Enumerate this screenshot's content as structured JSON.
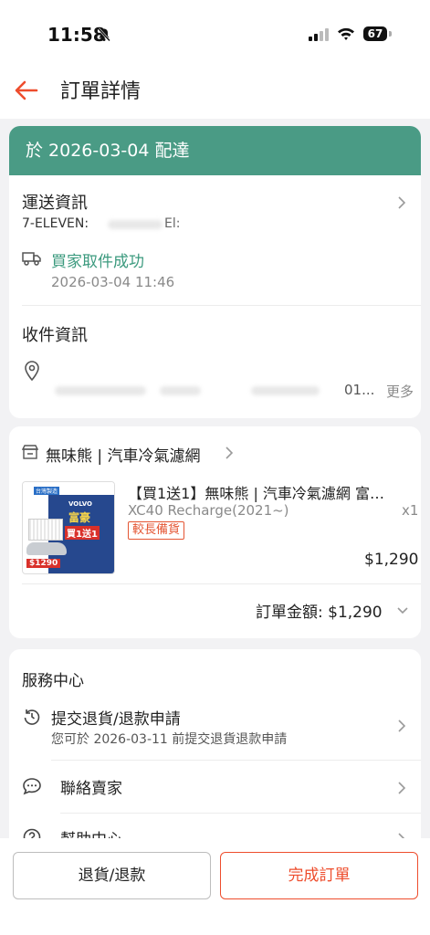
{
  "status_bar": {
    "time": "11:58",
    "battery": "67"
  },
  "header": {
    "title": "訂單詳情"
  },
  "delivery": {
    "banner": "於 2026-03-04 配達"
  },
  "shipping": {
    "title": "運送資訊",
    "store": "7-ELEVEN:",
    "store_fragment": "El:",
    "status": "買家取件成功",
    "status_time": "2026-03-04 11:46"
  },
  "recipient": {
    "title": "收件資訊",
    "address_end": "01...",
    "more": "更多"
  },
  "shop": {
    "name": "無味熊 | 汽車冷氣濾網"
  },
  "product": {
    "title": "【買1送1】無味熊 | 汽車冷氣濾網 富…",
    "variant": "XC40 Recharge(2021~)",
    "qty": "x1",
    "tag": "較長備貨",
    "price": "$1,290",
    "thumb_brand": "VOLVO",
    "thumb_line1": "富豪",
    "thumb_line2": "買1送1",
    "thumb_price": "$1290",
    "thumb_badge": "台灣製造"
  },
  "order_total": {
    "label": "訂單金額: $1,290"
  },
  "service": {
    "title": "服務中心",
    "items": [
      {
        "label": "提交退貨/退款申請",
        "sub": "您可於 2026-03-11 前提交退貨退款申請",
        "icon": "return-icon"
      },
      {
        "label": "聯絡賣家",
        "sub": "",
        "icon": "chat-icon"
      },
      {
        "label": "幫助中心",
        "sub": "",
        "icon": "help-icon"
      }
    ]
  },
  "actions": {
    "refund": "退貨/退款",
    "complete": "完成訂單"
  },
  "colors": {
    "accent": "#ee4d2d",
    "banner": "#4a9b85",
    "success": "#3b9a7e"
  }
}
